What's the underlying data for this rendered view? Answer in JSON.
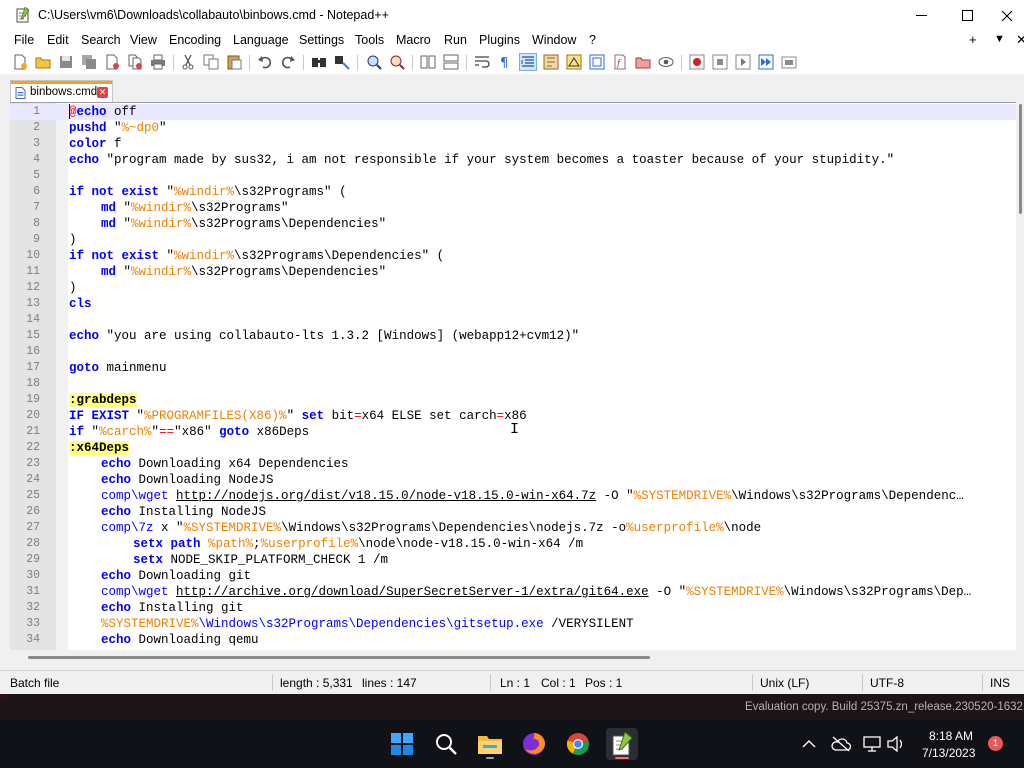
{
  "window": {
    "title": "C:\\Users\\vm6\\Downloads\\collabauto\\binbows.cmd - Notepad++"
  },
  "menu": {
    "items": [
      "File",
      "Edit",
      "Search",
      "View",
      "Encoding",
      "Language",
      "Settings",
      "Tools",
      "Macro",
      "Run",
      "Plugins",
      "Window",
      "?"
    ],
    "right_plus": "+",
    "right_down": "▼",
    "right_close": "✕"
  },
  "toolbar": {
    "icons": [
      "new-file-icon",
      "open-file-icon",
      "save-icon",
      "save-all-icon",
      "close-file-icon",
      "close-all-icon",
      "print-icon",
      "cut-icon",
      "copy-icon",
      "paste-icon",
      "undo-icon",
      "redo-icon",
      "find-icon",
      "replace-icon",
      "zoom-in-icon",
      "zoom-out-icon",
      "sync-vertical-icon",
      "sync-horizontal-icon",
      "word-wrap-icon",
      "show-all-chars-icon",
      "indent-guide-icon",
      "user-language-icon",
      "document-map-icon",
      "function-list-icon",
      "folder-as-workspace-icon",
      "monitoring-icon",
      "record-macro-icon",
      "stop-macro-icon",
      "play-macro-icon",
      "run-macro-multiple-icon",
      "save-macro-icon"
    ]
  },
  "tab": {
    "label": "binbows.cmd",
    "close": "✕"
  },
  "editor": {
    "lines": [
      {
        "n": "1",
        "indent": 0,
        "current": true,
        "tokens": [
          {
            "t": "@",
            "c": "at"
          },
          {
            "t": "echo",
            "c": "kw"
          },
          {
            "t": " off",
            "c": ""
          }
        ]
      },
      {
        "n": "2",
        "indent": 0,
        "tokens": [
          {
            "t": "pushd",
            "c": "kw"
          },
          {
            "t": " \"",
            "c": ""
          },
          {
            "t": "%~dp0",
            "c": "var"
          },
          {
            "t": "\"",
            "c": ""
          }
        ]
      },
      {
        "n": "3",
        "indent": 0,
        "tokens": [
          {
            "t": "color",
            "c": "kw"
          },
          {
            "t": " f",
            "c": ""
          }
        ]
      },
      {
        "n": "4",
        "indent": 0,
        "tokens": [
          {
            "t": "echo",
            "c": "kw"
          },
          {
            "t": " \"program made by sus32, i am not responsible if your system becomes a toaster because of your stupidity.\"",
            "c": ""
          }
        ]
      },
      {
        "n": "5",
        "indent": 0,
        "tokens": []
      },
      {
        "n": "6",
        "indent": 0,
        "tokens": [
          {
            "t": "if not exist",
            "c": "kw"
          },
          {
            "t": " \"",
            "c": ""
          },
          {
            "t": "%windir%",
            "c": "var"
          },
          {
            "t": "\\s32Programs\" (",
            "c": ""
          }
        ]
      },
      {
        "n": "7",
        "indent": 1,
        "tokens": [
          {
            "t": "md",
            "c": "kw"
          },
          {
            "t": " \"",
            "c": ""
          },
          {
            "t": "%windir%",
            "c": "var"
          },
          {
            "t": "\\s32Programs\"",
            "c": ""
          }
        ]
      },
      {
        "n": "8",
        "indent": 1,
        "tokens": [
          {
            "t": "md",
            "c": "kw"
          },
          {
            "t": " \"",
            "c": ""
          },
          {
            "t": "%windir%",
            "c": "var"
          },
          {
            "t": "\\s32Programs\\Dependencies\"",
            "c": ""
          }
        ]
      },
      {
        "n": "9",
        "indent": 0,
        "tokens": [
          {
            "t": ")",
            "c": ""
          }
        ]
      },
      {
        "n": "10",
        "indent": 0,
        "tokens": [
          {
            "t": "if not exist",
            "c": "kw"
          },
          {
            "t": " \"",
            "c": ""
          },
          {
            "t": "%windir%",
            "c": "var"
          },
          {
            "t": "\\s32Programs\\Dependencies\" (",
            "c": ""
          }
        ]
      },
      {
        "n": "11",
        "indent": 1,
        "tokens": [
          {
            "t": "md",
            "c": "kw"
          },
          {
            "t": " \"",
            "c": ""
          },
          {
            "t": "%windir%",
            "c": "var"
          },
          {
            "t": "\\s32Programs\\Dependencies\"",
            "c": ""
          }
        ]
      },
      {
        "n": "12",
        "indent": 0,
        "tokens": [
          {
            "t": ")",
            "c": ""
          }
        ]
      },
      {
        "n": "13",
        "indent": 0,
        "tokens": [
          {
            "t": "cls",
            "c": "kw"
          }
        ]
      },
      {
        "n": "14",
        "indent": 0,
        "tokens": []
      },
      {
        "n": "15",
        "indent": 0,
        "tokens": [
          {
            "t": "echo",
            "c": "kw"
          },
          {
            "t": " \"you are using collabauto-lts 1.3.2 [Windows] (webapp12+cvm12)\"",
            "c": ""
          }
        ]
      },
      {
        "n": "16",
        "indent": 0,
        "tokens": []
      },
      {
        "n": "17",
        "indent": 0,
        "tokens": [
          {
            "t": "goto",
            "c": "kw"
          },
          {
            "t": " mainmenu",
            "c": ""
          }
        ]
      },
      {
        "n": "18",
        "indent": 0,
        "tokens": []
      },
      {
        "n": "19",
        "indent": 0,
        "tokens": [
          {
            "t": ":grabdeps",
            "c": "label"
          }
        ]
      },
      {
        "n": "20",
        "indent": 0,
        "tokens": [
          {
            "t": "IF EXIST",
            "c": "kw"
          },
          {
            "t": " \"",
            "c": ""
          },
          {
            "t": "%PROGRAMFILES(X86)%",
            "c": "var"
          },
          {
            "t": "\" ",
            "c": ""
          },
          {
            "t": "set",
            "c": "kw"
          },
          {
            "t": " bit",
            "c": ""
          },
          {
            "t": "=",
            "c": "op"
          },
          {
            "t": "x64 ELSE set carch",
            "c": ""
          },
          {
            "t": "=",
            "c": "op"
          },
          {
            "t": "x86",
            "c": ""
          }
        ]
      },
      {
        "n": "21",
        "indent": 0,
        "tokens": [
          {
            "t": "if",
            "c": "kw"
          },
          {
            "t": " \"",
            "c": ""
          },
          {
            "t": "%carch%",
            "c": "var"
          },
          {
            "t": "\"",
            "c": ""
          },
          {
            "t": "==",
            "c": "op"
          },
          {
            "t": "\"x86\" ",
            "c": ""
          },
          {
            "t": "goto",
            "c": "kw"
          },
          {
            "t": " x86Deps",
            "c": ""
          }
        ]
      },
      {
        "n": "22",
        "indent": 0,
        "tokens": [
          {
            "t": ":x64Deps",
            "c": "label"
          }
        ]
      },
      {
        "n": "23",
        "indent": 1,
        "tokens": [
          {
            "t": "echo",
            "c": "kw"
          },
          {
            "t": " Downloading x64 Dependencies",
            "c": ""
          }
        ]
      },
      {
        "n": "24",
        "indent": 1,
        "tokens": [
          {
            "t": "echo",
            "c": "kw"
          },
          {
            "t": " Downloading NodeJS",
            "c": ""
          }
        ]
      },
      {
        "n": "25",
        "indent": 1,
        "tokens": [
          {
            "t": "comp\\wget",
            "c": "dep"
          },
          {
            "t": " ",
            "c": ""
          },
          {
            "t": "http://nodejs.org/dist/v18.15.0/node-v18.15.0-win-x64.7z",
            "c": "url"
          },
          {
            "t": " -O \"",
            "c": ""
          },
          {
            "t": "%SYSTEMDRIVE%",
            "c": "var"
          },
          {
            "t": "\\Windows\\s32Programs\\Dependenc…",
            "c": ""
          }
        ]
      },
      {
        "n": "26",
        "indent": 1,
        "tokens": [
          {
            "t": "echo",
            "c": "kw"
          },
          {
            "t": " Installing NodeJS",
            "c": ""
          }
        ]
      },
      {
        "n": "27",
        "indent": 1,
        "tokens": [
          {
            "t": "comp\\7z",
            "c": "dep"
          },
          {
            "t": " x \"",
            "c": ""
          },
          {
            "t": "%SYSTEMDRIVE%",
            "c": "var"
          },
          {
            "t": "\\Windows\\s32Programs\\Dependencies\\nodejs.7z -o",
            "c": ""
          },
          {
            "t": "%userprofile%",
            "c": "var"
          },
          {
            "t": "\\node",
            "c": ""
          }
        ]
      },
      {
        "n": "28",
        "indent": 2,
        "tokens": [
          {
            "t": "setx path",
            "c": "kw"
          },
          {
            "t": " ",
            "c": ""
          },
          {
            "t": "%path%",
            "c": "var"
          },
          {
            "t": ";",
            "c": ""
          },
          {
            "t": "%userprofile%",
            "c": "var"
          },
          {
            "t": "\\node\\node-v18.15.0-win-x64 /m",
            "c": ""
          }
        ]
      },
      {
        "n": "29",
        "indent": 2,
        "tokens": [
          {
            "t": "setx",
            "c": "kw"
          },
          {
            "t": " NODE_SKIP_PLATFORM_CHECK 1 /m",
            "c": ""
          }
        ]
      },
      {
        "n": "30",
        "indent": 1,
        "tokens": [
          {
            "t": "echo",
            "c": "kw"
          },
          {
            "t": " Downloading git",
            "c": ""
          }
        ]
      },
      {
        "n": "31",
        "indent": 1,
        "tokens": [
          {
            "t": "comp\\wget",
            "c": "dep"
          },
          {
            "t": " ",
            "c": ""
          },
          {
            "t": "http://archive.org/download/SuperSecretServer-1/extra/git64.exe",
            "c": "url"
          },
          {
            "t": " -O \"",
            "c": ""
          },
          {
            "t": "%SYSTEMDRIVE%",
            "c": "var"
          },
          {
            "t": "\\Windows\\s32Programs\\Dep…",
            "c": ""
          }
        ]
      },
      {
        "n": "32",
        "indent": 1,
        "tokens": [
          {
            "t": "echo",
            "c": "kw"
          },
          {
            "t": " Installing git",
            "c": ""
          }
        ]
      },
      {
        "n": "33",
        "indent": 1,
        "tokens": [
          {
            "t": "%SYSTEMDRIVE%",
            "c": "var"
          },
          {
            "t": "\\Windows\\s32Programs\\Dependencies\\gitsetup.exe",
            "c": "dep"
          },
          {
            "t": " /VERYSILENT",
            "c": ""
          }
        ]
      },
      {
        "n": "34",
        "indent": 1,
        "tokens": [
          {
            "t": "echo",
            "c": "kw"
          },
          {
            "t": " Downloading qemu",
            "c": ""
          }
        ]
      }
    ]
  },
  "status": {
    "file_type": "Batch file",
    "length": "length : 5,331",
    "lines": "lines : 147",
    "ln": "Ln : 1",
    "col": "Col : 1",
    "pos": "Pos : 1",
    "eol": "Unix (LF)",
    "encoding": "UTF-8",
    "mode": "INS"
  },
  "watermark": "Evaluation copy. Build 25375.zn_release.230520-1632",
  "taskbar": {
    "apps": [
      "start-icon",
      "search-icon",
      "file-explorer-icon",
      "firefox-icon",
      "chrome-icon",
      "notepadpp-icon"
    ],
    "clock_time": "8:18 AM",
    "clock_date": "7/13/2023",
    "notification_count": "1"
  },
  "colors": {
    "keyword": "#0000ff",
    "variable": "#f08000",
    "label_bg": "#ffff80",
    "operator": "#ff0000",
    "current_line": "#e8e8ff",
    "tab_accent": "#f3a323",
    "taskbar": "#101217"
  }
}
